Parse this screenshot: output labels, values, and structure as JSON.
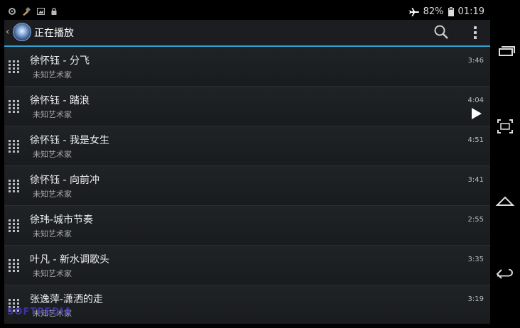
{
  "status_bar": {
    "battery": "82%",
    "time": "01:19",
    "left_icons": [
      "settings-icon",
      "flashlight-icon",
      "image-icon",
      "lock-icon"
    ]
  },
  "action_bar": {
    "title": "正在播放",
    "accent_color": "#33a2d1"
  },
  "tracks": [
    {
      "title": "徐怀钰 - 分飞",
      "artist": "未知艺术家",
      "duration": "3:46",
      "playing": false
    },
    {
      "title": "徐怀钰 - 踏浪",
      "artist": "未知艺术家",
      "duration": "4:04",
      "playing": true
    },
    {
      "title": "徐怀钰 - 我是女生",
      "artist": "未知艺术家",
      "duration": "4:51",
      "playing": false
    },
    {
      "title": "徐怀钰 - 向前冲",
      "artist": "未知艺术家",
      "duration": "3:41",
      "playing": false
    },
    {
      "title": "徐玮-城市节奏",
      "artist": "未知艺术家",
      "duration": "2:55",
      "playing": false
    },
    {
      "title": "叶凡 - 新水调歌头",
      "artist": "未知艺术家",
      "duration": "3:35",
      "playing": false
    },
    {
      "title": "张逸萍-潇洒的走",
      "artist": "未知艺术家",
      "duration": "3:19",
      "playing": false
    }
  ],
  "navigation_bar": [
    "recent-apps-icon",
    "screenshot-icon",
    "home-icon",
    "back-icon"
  ],
  "watermark": "SOFTPEDIA"
}
